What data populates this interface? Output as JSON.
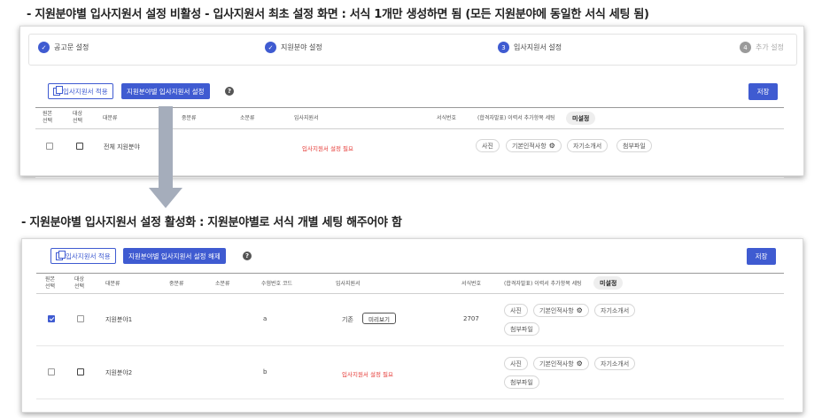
{
  "captions": {
    "top": "- 지원분야별 입사지원서 설정 비활성 - 입사지원서 최초 설정 화면 : 서식 1개만 생성하면 됨 (모든 지원분야에 동일한 서식 세팅 됨)",
    "bottom": "- 지원분야별 입사지원서 설정 활성화 : 지원분야별로 서식 개별 세팅 해주어야 함"
  },
  "colors": {
    "accent": "#3f5bd1",
    "error": "#e53935",
    "arrow": "#a5adbb"
  },
  "stepper": [
    {
      "label": "공고문 설정",
      "state": "done",
      "marker": "✓"
    },
    {
      "label": "지원분야 설정",
      "state": "done",
      "marker": "✓"
    },
    {
      "label": "입사지원서 설정",
      "state": "current",
      "marker": "3"
    },
    {
      "label": "추가 설정",
      "state": "todo",
      "marker": "4"
    }
  ],
  "panel1": {
    "toolbar": {
      "copy_button": "입사지원서 적용",
      "toggle_button": "지원분야별 입사지원서 설정",
      "help": "?",
      "save": "저장"
    },
    "headers": {
      "original_select": "원본\n선택",
      "target_select": "대상\n선택",
      "major": "대분류",
      "middle": "중분류",
      "minor": "소분류",
      "form": "입사지원서",
      "form_no": "서식번호",
      "extra_items": "(합격자발표) 이력서 추가항목 세팅",
      "unset": "미설정"
    },
    "row": {
      "category": "전체 지원분야",
      "form_status": "입사지원서 설정 필요",
      "chips": [
        "사진",
        "기본인적사항",
        "자기소개서",
        "첨부파일"
      ]
    }
  },
  "panel2": {
    "toolbar": {
      "copy_button": "입사지원서 적용",
      "toggle_button": "지원분야별 입사지원서 설정 해제",
      "help": "?",
      "save": "저장"
    },
    "headers": {
      "original_select": "원본\n선택",
      "target_select": "대상\n선택",
      "major": "대분류",
      "middle": "중분류",
      "minor": "소분류",
      "exam_code": "수험번호 코드",
      "form": "입사지원서",
      "form_no": "서식번호",
      "extra_items": "(합격자발표) 이력서 추가항목 세팅",
      "unset": "미설정"
    },
    "rows": [
      {
        "category": "지원분야1",
        "code": "a",
        "form_label": "기존",
        "preview_button": "미리보기",
        "form_no": "2707",
        "chips": [
          "사진",
          "기본인적사항",
          "자기소개서",
          "첨부파일"
        ],
        "original_checked": true
      },
      {
        "category": "지원분야2",
        "code": "b",
        "form_status": "입사지원서 설정 필요",
        "chips": [
          "사진",
          "기본인적사항",
          "자기소개서",
          "첨부파일"
        ],
        "original_checked": false
      }
    ]
  }
}
